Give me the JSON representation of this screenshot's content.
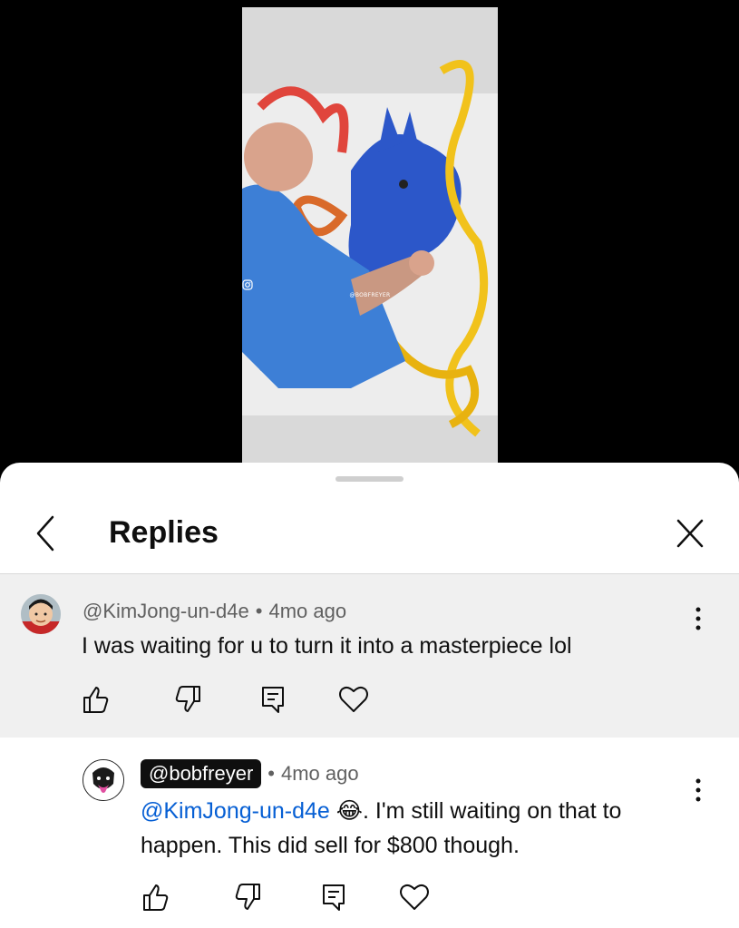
{
  "video": {
    "watermark_handle": "@BOBFREYER"
  },
  "replies_panel": {
    "title": "Replies"
  },
  "parent_comment": {
    "author": "@KimJong-un-d4e",
    "separator": "•",
    "time": "4mo ago",
    "text": "I was waiting for u to turn it into a masterpiece lol"
  },
  "reply": {
    "author": "@bobfreyer",
    "separator": "•",
    "time": "4mo ago",
    "mention": "@KimJong-un-d4e",
    "emoji": "😂",
    "text_line1": ". I'm still waiting on that to",
    "text_line2": "happen. This did sell for $800 though."
  },
  "icons": [
    "back-arrow-icon",
    "close-icon",
    "more-vertical-icon",
    "thumbs-up-icon",
    "thumbs-down-icon",
    "reply-icon",
    "heart-icon",
    "instagram-icon"
  ]
}
